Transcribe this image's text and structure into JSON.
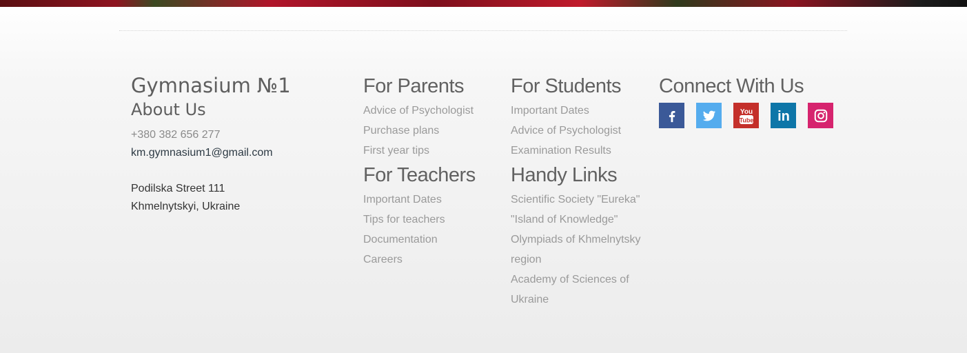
{
  "about": {
    "title": "Gymnasium №1",
    "subtitle": "About Us",
    "phone": "+380 382 656 277",
    "email": "km.gymnasium1@gmail.com",
    "address_line1": "Podilska Street 111",
    "address_line2": "Khmelnytskyi, Ukraine"
  },
  "parents": {
    "heading": "For Parents",
    "links": [
      "Advice of Psychologist",
      "Purchase plans",
      "First year tips"
    ]
  },
  "teachers": {
    "heading": "For Teachers",
    "links": [
      "Important Dates",
      "Tips for teachers",
      "Documentation",
      "Careers"
    ]
  },
  "students": {
    "heading": "For Students",
    "links": [
      "Important Dates",
      "Advice of Psychologist",
      "Examination Results"
    ]
  },
  "handy": {
    "heading": "Handy Links",
    "links": [
      "Scientific Society \"Eureka\"",
      "\"Island of Knowledge\"",
      "Olympiads of Khmelnytsky region",
      "Academy of Sciences of Ukraine"
    ]
  },
  "connect": {
    "heading": "Connect With Us",
    "icons": [
      "facebook-icon",
      "twitter-icon",
      "youtube-icon",
      "linkedin-icon",
      "instagram-icon"
    ],
    "youtube_text_1": "You",
    "youtube_text_2": "Tube",
    "linkedin_text": "in"
  },
  "colors": {
    "facebook": "#3b5998",
    "twitter": "#55acee",
    "youtube": "#c4302b",
    "linkedin": "#0e76a8",
    "instagram": "#d6246e"
  }
}
